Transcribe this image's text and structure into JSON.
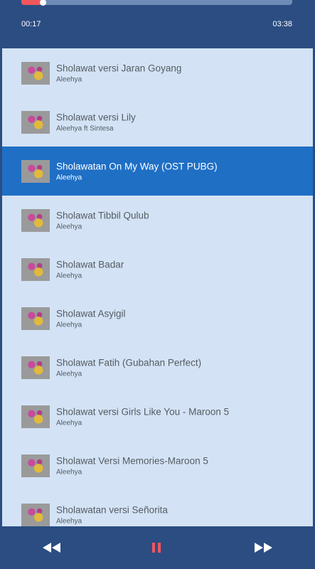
{
  "player": {
    "elapsed": "00:17",
    "total": "03:38",
    "progress_fraction": 0.078,
    "accent_color": "#f0575c"
  },
  "playlist": [
    {
      "title": "Sholawat versi Jaran Goyang",
      "artist": "Aleehya",
      "active": false
    },
    {
      "title": "Sholawat versi Lily",
      "artist": "Aleehya ft Sintesa",
      "active": false
    },
    {
      "title": "Sholawatan On My Way (OST PUBG)",
      "artist": "Aleehya",
      "active": true
    },
    {
      "title": "Sholawat Tibbil Qulub",
      "artist": "Aleehya",
      "active": false
    },
    {
      "title": "Sholawat Badar",
      "artist": "Aleehya",
      "active": false
    },
    {
      "title": "Sholawat Asyigil",
      "artist": "Aleehya",
      "active": false
    },
    {
      "title": "Sholawat Fatih (Gubahan Perfect)",
      "artist": "Aleehya",
      "active": false
    },
    {
      "title": "Sholawat versi Girls Like You - Maroon 5",
      "artist": "Aleehya",
      "active": false
    },
    {
      "title": "Sholawat Versi Memories-Maroon 5",
      "artist": "Aleehya",
      "active": false
    },
    {
      "title": "Sholawatan versi Señorita",
      "artist": "Aleehya",
      "active": false
    }
  ],
  "controls": {
    "prev_icon": "rewind-icon",
    "pause_icon": "pause-icon",
    "next_icon": "fast-forward-icon"
  }
}
